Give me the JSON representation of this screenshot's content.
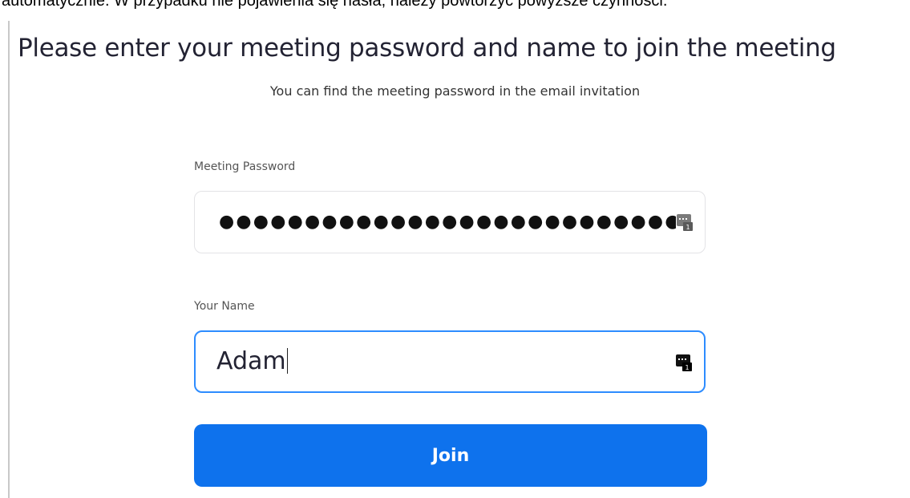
{
  "instruction_text": "automatycznie. W przypadku nie pojawienia się hasła, należy powtórzyć powyższe czynności.",
  "form": {
    "title": "Please enter your meeting password and name to join the meeting",
    "subtitle": "You can find the meeting password in the email invitation",
    "password_label": "Meeting Password",
    "password_mask": "●●●●●●●●●●●●●●●●●●●●●●●●●●●●●●",
    "name_label": "Your Name",
    "name_value": "Adam",
    "join_label": "Join"
  },
  "icons": {
    "password_manager_icon": "key-icon",
    "password_manager_icon_active": "key-icon"
  },
  "colors": {
    "primary_button": "#0e72ed",
    "focused_border": "#2d8cff",
    "title_text": "#232333"
  }
}
